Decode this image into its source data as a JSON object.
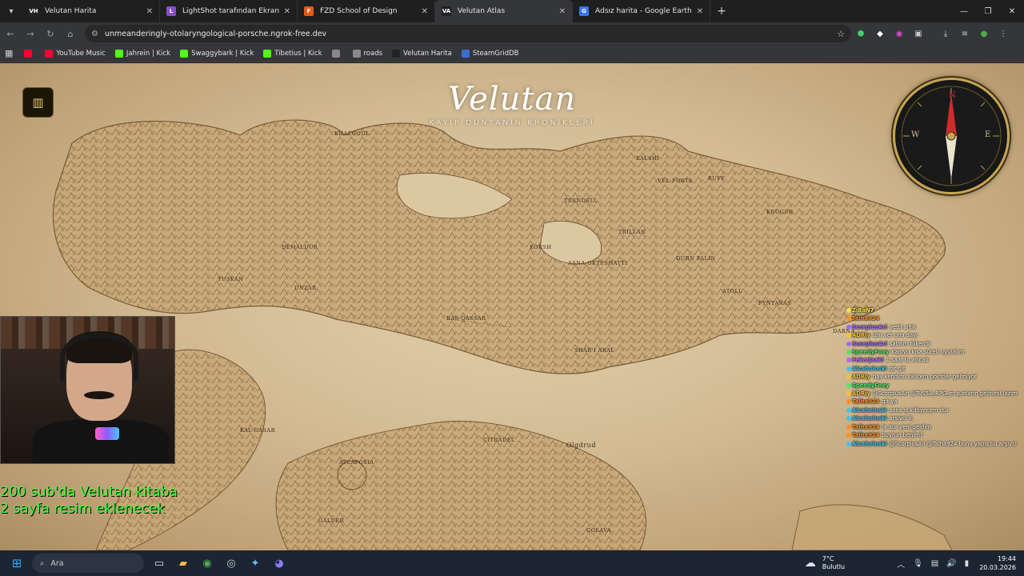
{
  "tabs": [
    {
      "title": "Velutan Harita",
      "fav": "VH",
      "fav_color": "#222222",
      "active": false
    },
    {
      "title": "LightShot tarafından Ekran Gör",
      "fav": "L",
      "fav_color": "#8a4ccf",
      "active": false
    },
    {
      "title": "FZD School of Design",
      "fav": "F",
      "fav_color": "#e55a1a",
      "active": false
    },
    {
      "title": "Velutan Atlas",
      "fav": "VA",
      "fav_color": "#222222",
      "active": true
    },
    {
      "title": "Adsız harita - Google Earth",
      "fav": "G",
      "fav_color": "#3a76f0",
      "active": false
    }
  ],
  "address_bar": {
    "url": "unmeanderingly-otolaryngological-porsche.ngrok-free.dev"
  },
  "bookmarks": [
    {
      "label": "",
      "icon": "youtube-icon",
      "color": "#ff0033"
    },
    {
      "label": "YouTube Music",
      "icon": "youtube-music-icon",
      "color": "#ff0033"
    },
    {
      "label": "Jahrein | Kick",
      "icon": "kick-icon",
      "color": "#53fc18"
    },
    {
      "label": "Swaggybark | Kick",
      "icon": "kick-icon",
      "color": "#53fc18"
    },
    {
      "label": "Tibetius | Kick",
      "icon": "kick-icon",
      "color": "#53fc18"
    },
    {
      "label": "",
      "icon": "globe-icon",
      "color": "#888888"
    },
    {
      "label": "roads",
      "icon": "roads-icon",
      "color": "#888888"
    },
    {
      "label": "Velutan Harita",
      "icon": "velutan-icon",
      "color": "#222222"
    },
    {
      "label": "SteamGridDB",
      "icon": "steamgriddb-icon",
      "color": "#3b6fd1"
    }
  ],
  "map": {
    "logo_text": "Velutan",
    "tagline": "KAYIP DÜNYANIN KRONİKLERİ",
    "labels": [
      "KHAZGOUL",
      "KALSHI",
      "RUFF",
      "TRENDELL",
      "VEL-FORTA",
      "KRUGOR",
      "TRILLAN",
      "DURN FALIN",
      "KORSH",
      "ASNA-OKTESHATTI",
      "DEMALDUR",
      "UNZAR",
      "TUSKAN",
      "RAS QASSAR",
      "ATOLL",
      "FYNTARAS",
      "DARNA",
      "SHAR'I ARAL",
      "CITRADEL",
      "Olgdrud",
      "KAL GASAR",
      "ATLAPOSIA",
      "GALDER",
      "GOLAVA"
    ],
    "compass": {
      "n": "N",
      "e": "E",
      "w": "W"
    }
  },
  "stream_overlay": {
    "goal_text": "200 sub'da Velutan kitaba 2 sayfa resim eklenecek",
    "chat": [
      {
        "user": "ZiBaN7",
        "msg": "",
        "color": "#f5e14a"
      },
      {
        "user": "Talha924",
        "msg": "",
        "color": "#ff8f1f"
      },
      {
        "user": "ScorpiusAri",
        "msg": "yetti artık",
        "color": "#9f6bff"
      },
      {
        "user": "ADRiy",
        "msg": "izin ver ona dayı",
        "color": "#f5c33a"
      },
      {
        "user": "ScorpiusAri",
        "msg": "sabrım tükendi",
        "color": "#9f6bff"
      },
      {
        "user": "SpeedyFoxy",
        "msg": "Kajuyu kısa süreli uyutalım",
        "color": "#4de86b"
      },
      {
        "user": "Fekerjaaki",
        "msg": "1 saat to atıcaö",
        "color": "#b06bff"
      },
      {
        "user": "Alcaholoski",
        "msg": "git git",
        "color": "#39c6f2"
      },
      {
        "user": "ADRiy",
        "msg": "hay kendimi sikicem pointler gelmiyor",
        "color": "#f5c33a"
      },
      {
        "user": "SpeedyFoxy",
        "msg": "",
        "color": "#4de86b"
      },
      {
        "user": "ADRiy",
        "msg": "@ScorpiusAri @TuS5A_RPG_m şunların gelmesi lazım",
        "color": "#f5c33a"
      },
      {
        "user": "Talha924",
        "msg": "git ya",
        "color": "#ff8f1f"
      },
      {
        "user": "Alcaholoski",
        "msg": "sana iş kitliyecem dur",
        "color": "#39c6f2"
      },
      {
        "user": "Alcaholoski",
        "msg": "arşivci il,",
        "color": "#39c6f2"
      },
      {
        "user": "Talha924",
        "msg": "la dur yeni geldim",
        "color": "#ff8f1f"
      },
      {
        "user": "Talha924",
        "msg": "buyrun benim?",
        "color": "#ff8f1f"
      },
      {
        "user": "Alcaholoski",
        "msg": "@ScorpiusAri @Talha924 bunu yapış bu arşivci",
        "color": "#39c6f2"
      }
    ]
  },
  "taskbar": {
    "search_placeholder": "Ara",
    "weather_temp": "7°C",
    "weather_desc": "Bulutlu",
    "time": "19:44",
    "date": "20.03.2026"
  },
  "colors": {
    "accent_green": "#39ff39",
    "compass_gold": "#c6a552"
  }
}
